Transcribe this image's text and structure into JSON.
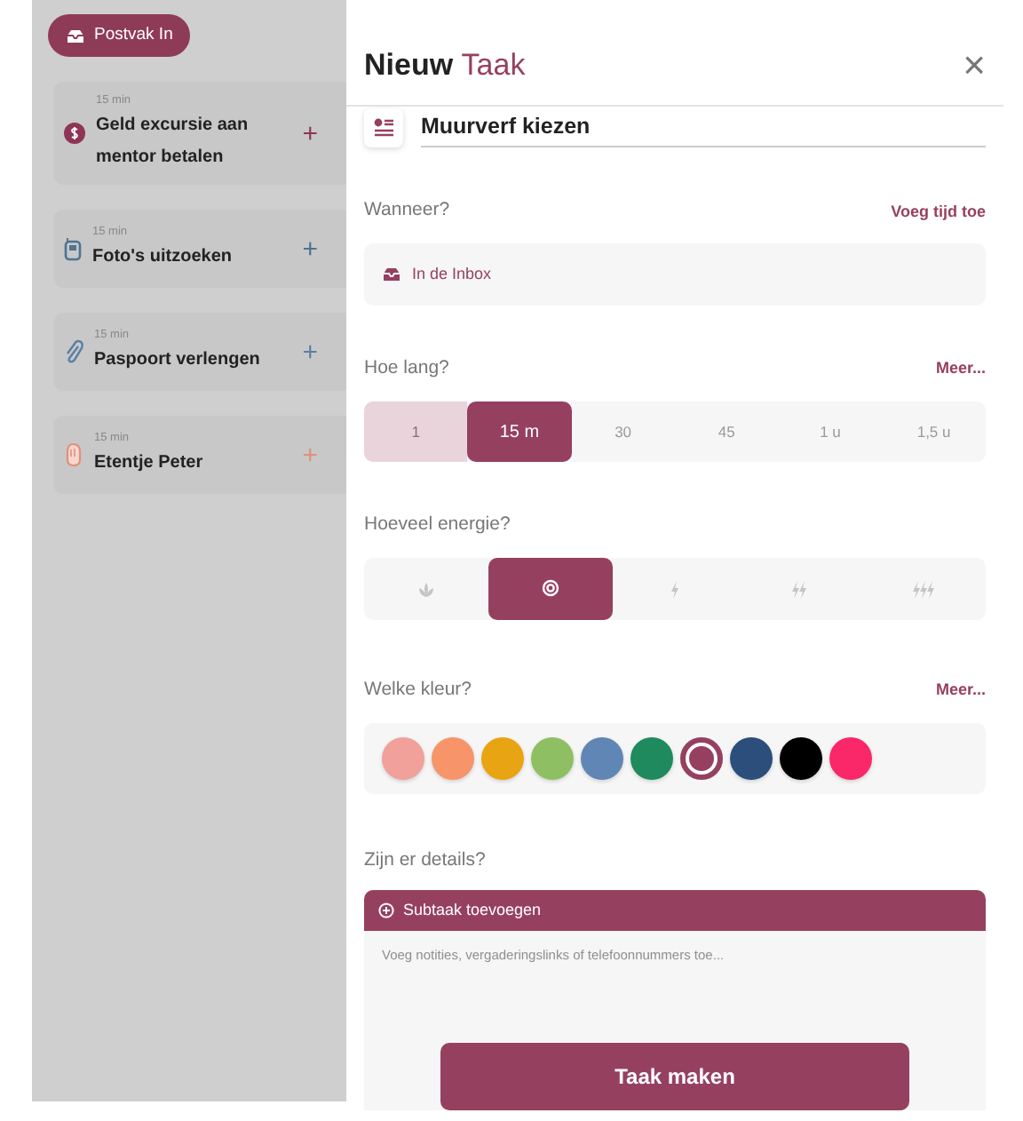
{
  "inbox_button": {
    "label": "Postvak In"
  },
  "tasks": [
    {
      "duration": "15 min",
      "title": "Geld excursie aan mentor betalen",
      "kind": "coin",
      "color": "#8e3555",
      "add": "+"
    },
    {
      "duration": "15 min",
      "title": "Foto's uitzoeken",
      "kind": "phone",
      "color": "#4f7390",
      "add": "+"
    },
    {
      "duration": "15 min",
      "title": "Paspoort verlengen",
      "kind": "paperclip",
      "color": "#5b7fa6",
      "add": "+"
    },
    {
      "duration": "15 min",
      "title": "Etentje Peter",
      "kind": "hand",
      "color": "#e0907c",
      "add": "+"
    }
  ],
  "modal": {
    "title": "Nieuw",
    "title_accent": "Taak",
    "close": "×",
    "task_name": "Muurverf kiezen",
    "when": {
      "label": "Wanneer?",
      "action": "Voeg tijd toe",
      "value": "In de Inbox"
    },
    "duration": {
      "label": "Hoe lang?",
      "action": "Meer...",
      "options": [
        {
          "label": "1",
          "selected": false,
          "in_range": true
        },
        {
          "label": "15 m",
          "selected": true,
          "in_range": false
        },
        {
          "label": "30",
          "selected": false,
          "in_range": false
        },
        {
          "label": "45",
          "selected": false,
          "in_range": false
        },
        {
          "label": "1 u",
          "selected": false,
          "in_range": false
        },
        {
          "label": "1,5 u",
          "selected": false,
          "in_range": false
        }
      ]
    },
    "energy": {
      "label": "Hoeveel energie?",
      "options": [
        {
          "kind": "rest",
          "selected": false
        },
        {
          "kind": "target",
          "selected": true
        },
        {
          "kind": "bolt1",
          "selected": false
        },
        {
          "kind": "bolt2",
          "selected": false
        },
        {
          "kind": "bolt3",
          "selected": false
        }
      ]
    },
    "color": {
      "label": "Welke kleur?",
      "action": "Meer...",
      "options": [
        {
          "color": "#f1a09a",
          "selected": false
        },
        {
          "color": "#f7946a",
          "selected": false
        },
        {
          "color": "#e8a412",
          "selected": false
        },
        {
          "color": "#8fbf63",
          "selected": false
        },
        {
          "color": "#5f86b5",
          "selected": false
        },
        {
          "color": "#1f8a5e",
          "selected": false
        },
        {
          "color": "#96405f",
          "selected": true
        },
        {
          "color": "#2b4f7a",
          "selected": false
        },
        {
          "color": "#000000",
          "selected": false
        },
        {
          "color": "#fa2868",
          "selected": false
        }
      ]
    },
    "details": {
      "label": "Zijn er details?",
      "subtask": "Subtaak toevoegen",
      "placeholder": "Voeg notities, vergaderingslinks of telefoonnummers toe..."
    },
    "submit": "Taak maken"
  }
}
